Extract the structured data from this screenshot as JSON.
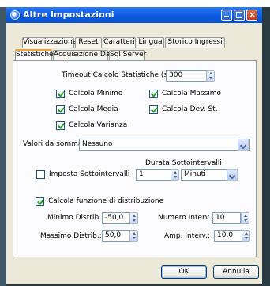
{
  "window": {
    "title": "Altre Impostazioni"
  },
  "tabs_row1": [
    "Visualizzazione",
    "Reset",
    "Caratteri",
    "Lingua",
    "Storico Ingressi"
  ],
  "tabs_row2": [
    "Statistiche",
    "Acquisizione Dati",
    "Sql Server"
  ],
  "active_tab": "Statistiche",
  "timeout": {
    "label": "Timeout Calcolo Statistiche (s):",
    "value": "300"
  },
  "checks": {
    "minimo": {
      "label": "Calcola Minimo",
      "checked": true
    },
    "massimo": {
      "label": "Calcola Massimo",
      "checked": true
    },
    "media": {
      "label": "Calcola Media",
      "checked": true
    },
    "devst": {
      "label": "Calcola Dev. St.",
      "checked": true
    },
    "varianza": {
      "label": "Calcola Varianza",
      "checked": true
    }
  },
  "valori": {
    "label": "Valori da sommare:",
    "value": "Nessuno"
  },
  "sottointervalli": {
    "label": "Imposta Sottointervalli",
    "checked": false,
    "durata_label": "Durata Sottointervalli:",
    "durata_value": "1",
    "unit_value": "Minuti"
  },
  "distribuzione": {
    "label": "Calcola funzione di distribuzione",
    "checked": true,
    "minimo_label": "Minimo Distrib.:",
    "minimo_value": "-50,0",
    "massimo_label": "Massimo Distrib.:",
    "massimo_value": "50,0",
    "numero_label": "Numero Interv.:",
    "numero_value": "10",
    "amp_label": "Amp. Interv.:",
    "amp_value": "10,0"
  },
  "buttons": {
    "ok": "OK",
    "annulla": "Annulla"
  }
}
